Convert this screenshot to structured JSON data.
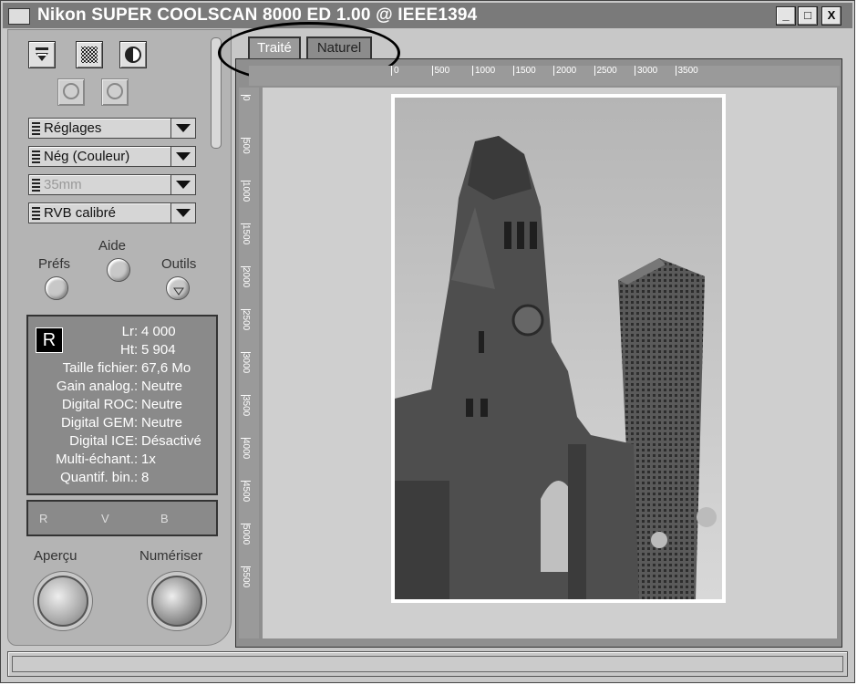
{
  "window": {
    "title": "Nikon SUPER COOLSCAN 8000 ED 1.00 @ IEEE1394",
    "buttons": {
      "minimize": "_",
      "maximize": "□",
      "close": "X"
    }
  },
  "toolbar": {
    "icons": [
      "eject-icon",
      "grain-icon",
      "contrast-icon",
      "zoom-out-icon",
      "zoom-in-icon"
    ]
  },
  "dropdowns": [
    {
      "label": "Réglages",
      "enabled": true
    },
    {
      "label": "Nég (Couleur)",
      "enabled": true
    },
    {
      "label": "35mm",
      "enabled": false
    },
    {
      "label": "RVB calibré",
      "enabled": true
    }
  ],
  "round_buttons": {
    "prefs": "Préfs",
    "help": "Aide",
    "tools": "Outils"
  },
  "info": {
    "badge": "R",
    "rows": [
      {
        "key": "Lr",
        "value": "4 000"
      },
      {
        "key": "Ht",
        "value": "5 904"
      },
      {
        "key": "Taille fichier",
        "value": "67,6 Mo"
      },
      {
        "key": "Gain analog.",
        "value": "Neutre"
      },
      {
        "key": "Digital ROC",
        "value": "Neutre"
      },
      {
        "key": "Digital GEM",
        "value": "Neutre"
      },
      {
        "key": "Digital ICE",
        "value": "Désactivé"
      },
      {
        "key": "Multi-échant.",
        "value": "1x"
      },
      {
        "key": "Quantif. bin.",
        "value": "8"
      }
    ]
  },
  "channels": {
    "r": "R",
    "v": "V",
    "b": "B"
  },
  "actions": {
    "preview": "Aperçu",
    "scan": "Numériser"
  },
  "tabs": [
    {
      "label": "Traité",
      "active": true
    },
    {
      "label": "Naturel",
      "active": false
    }
  ],
  "ruler": {
    "horizontal": [
      "0",
      "500",
      "1000",
      "1500",
      "2000",
      "2500",
      "3000",
      "3500"
    ],
    "vertical": [
      "0",
      "500",
      "1000",
      "1500",
      "2000",
      "2500",
      "3000",
      "3500",
      "4000",
      "4500",
      "5000",
      "5500"
    ]
  },
  "status": {
    "text": ""
  }
}
